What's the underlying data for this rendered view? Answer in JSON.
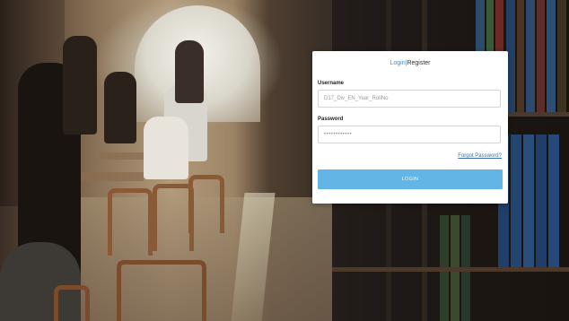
{
  "login": {
    "tab_login": "Login",
    "tab_separator": "|",
    "tab_register": "Register",
    "username_label": "Username",
    "username_placeholder": "D17_Div_EN_Year_RollNo",
    "password_label": "Password",
    "password_value": "••••••••••••",
    "forgot_password": "Forgot Password?",
    "login_button": "LOGIN"
  },
  "colors": {
    "accent_tab": "#3b8fd6",
    "button": "#63b5e6",
    "card": "#ffffff"
  },
  "background": {
    "icon": "library-reading-room-photo"
  }
}
